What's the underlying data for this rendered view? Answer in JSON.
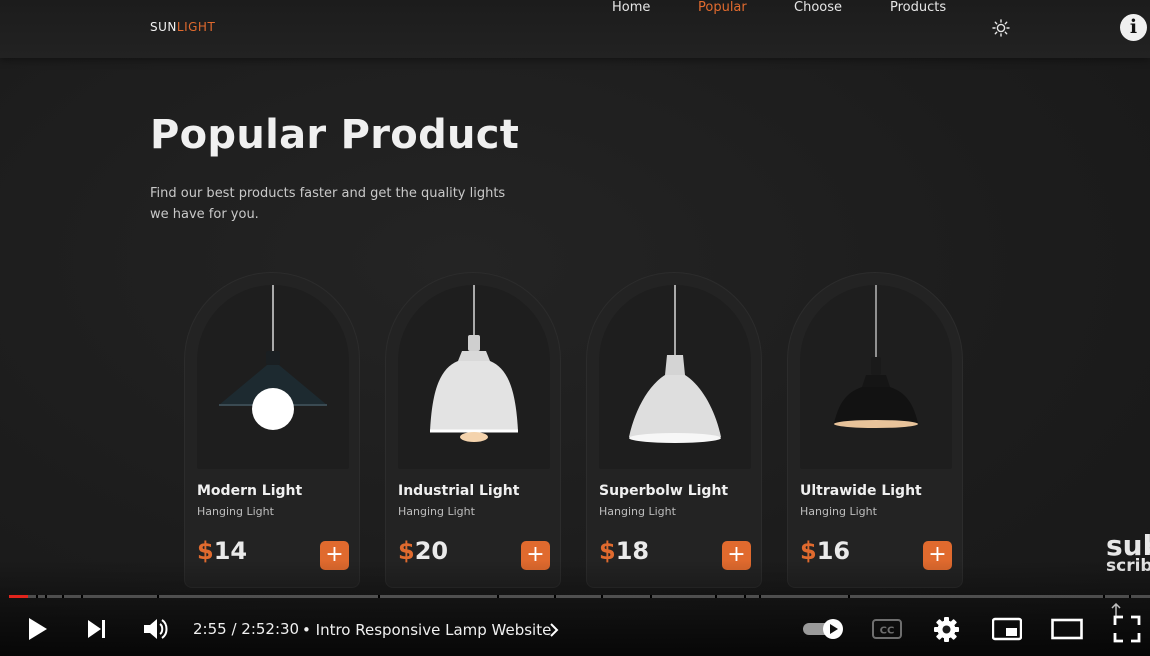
{
  "header": {
    "logo_main": "SUN",
    "logo_accent": "LIGHT",
    "nav": [
      {
        "label": "Home",
        "active": false
      },
      {
        "label": "Popular",
        "active": true
      },
      {
        "label": "Choose",
        "active": false
      },
      {
        "label": "Products",
        "active": false
      }
    ],
    "theme_icon": "sun-icon",
    "info_icon": "info-icon"
  },
  "section": {
    "title": "Popular Product",
    "description": "Find our best products faster and get the quality lights we have for you."
  },
  "products": [
    {
      "name": "Modern Light",
      "type": "Hanging Light",
      "currency": "$",
      "price": "14",
      "add_label": "+"
    },
    {
      "name": "Industrial Light",
      "type": "Hanging Light",
      "currency": "$",
      "price": "20",
      "add_label": "+"
    },
    {
      "name": "Superbolw Light",
      "type": "Hanging Light",
      "currency": "$",
      "price": "18",
      "add_label": "+"
    },
    {
      "name": "Ultrawide Light",
      "type": "Hanging Light",
      "currency": "$",
      "price": "16",
      "add_label": "+"
    }
  ],
  "watermark": {
    "line1": "sub",
    "line2": "scribe"
  },
  "player": {
    "time": "2:55 / 2:52:30",
    "chapter_separator": "•",
    "chapter": "Intro Responsive Lamp Website",
    "progress": 0.017,
    "autoplay": true,
    "colors": {
      "progress": "#e1241c",
      "accent": "#e06a2e"
    },
    "icons": [
      "play-icon",
      "next-icon",
      "volume-icon",
      "autoplay-toggle",
      "captions-icon",
      "settings-icon",
      "miniplayer-icon",
      "theater-icon",
      "fullscreen-icon"
    ]
  }
}
